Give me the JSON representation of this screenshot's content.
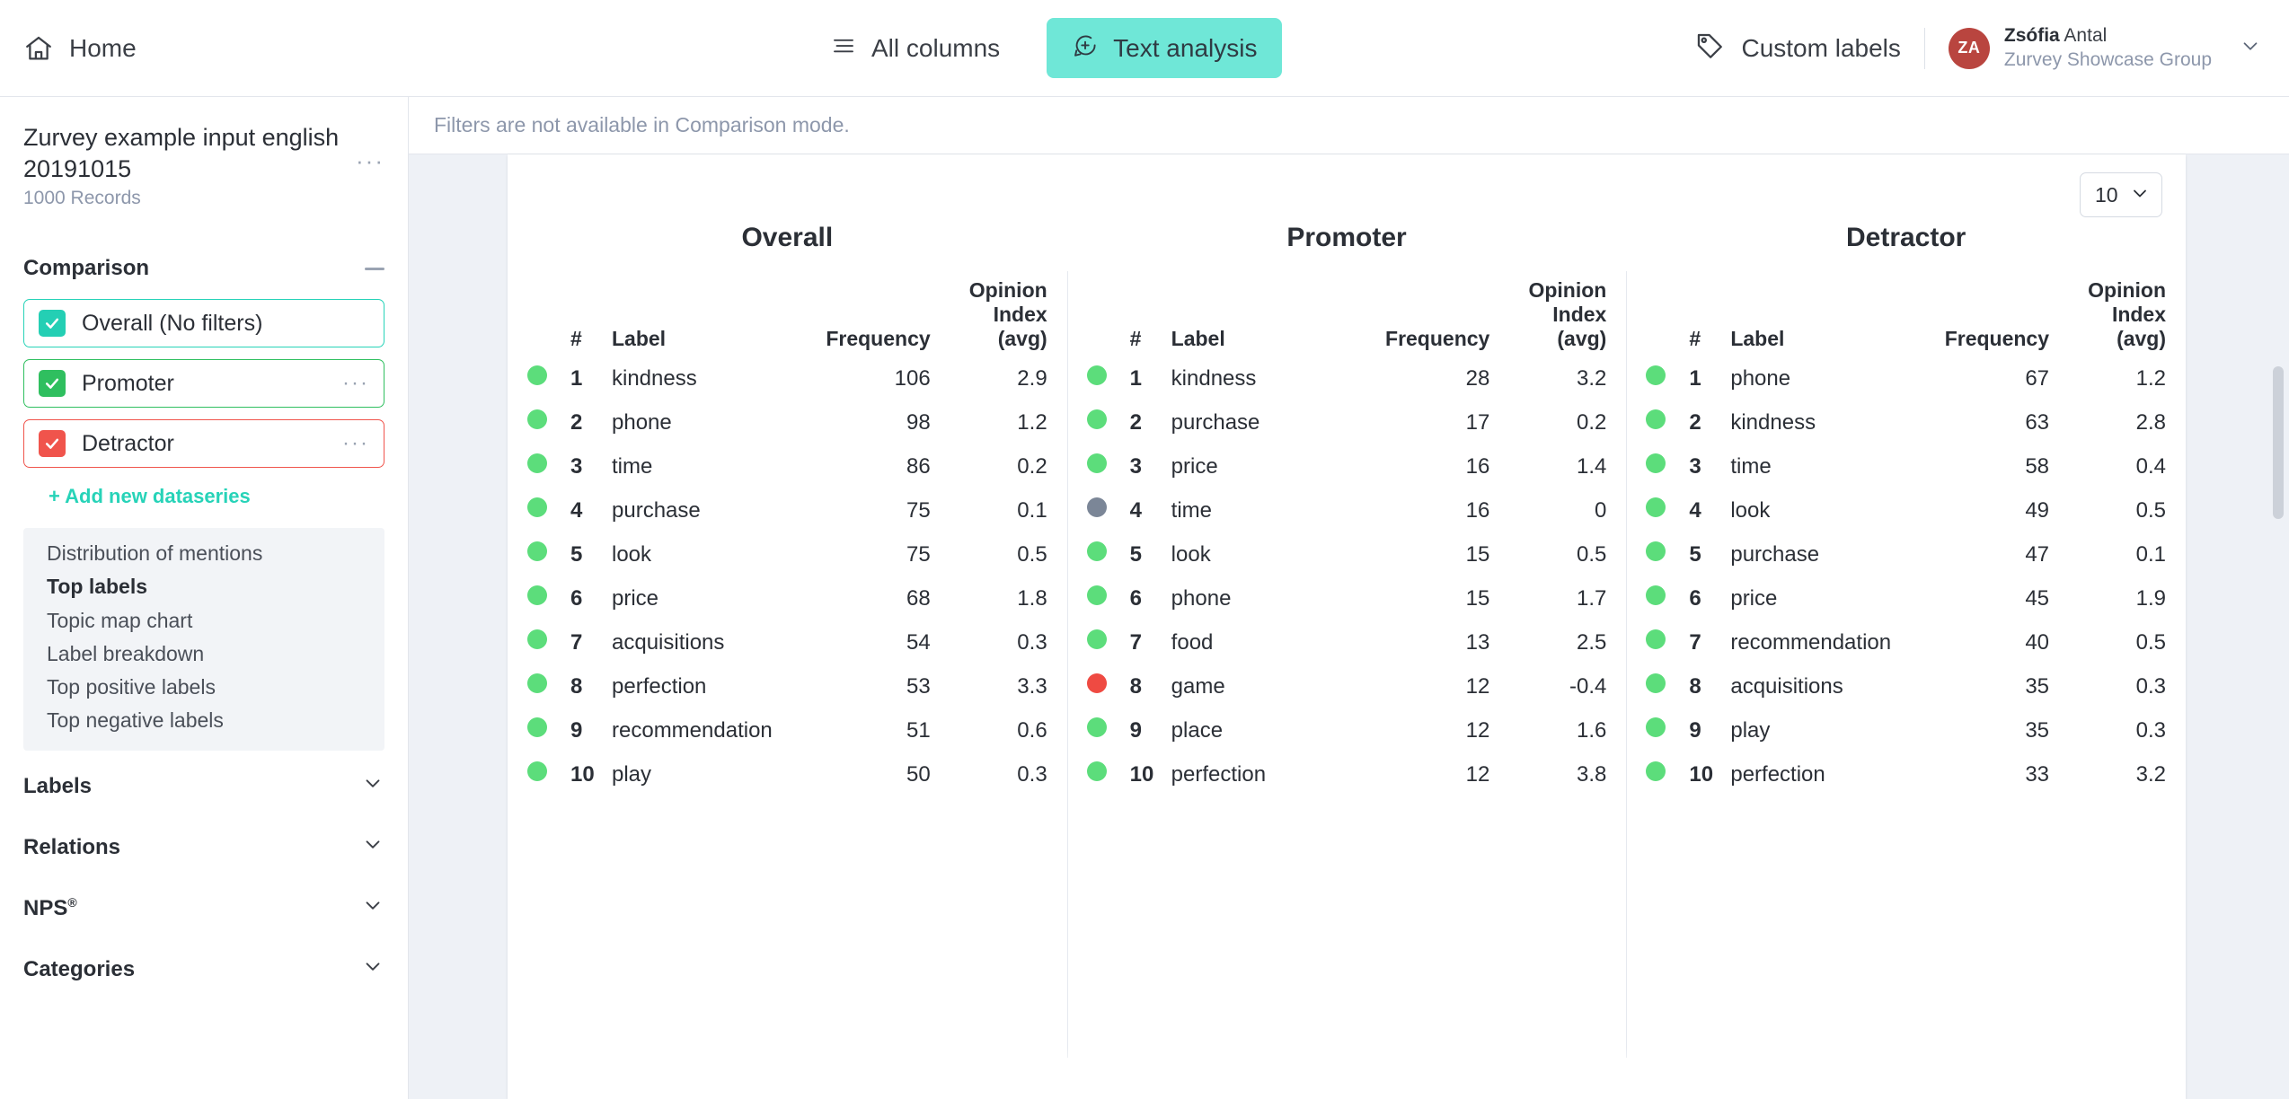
{
  "topbar": {
    "home_label": "Home",
    "all_columns_label": "All columns",
    "text_analysis_label": "Text analysis",
    "custom_labels_label": "Custom labels",
    "user_first_name": "Zsófia",
    "user_last_name": "Antal",
    "user_org": "Zurvey Showcase Group",
    "avatar_initials": "ZA",
    "accent_color": "#6fe7d7"
  },
  "sidebar": {
    "dataset_title": "Zurvey example input english 20191015",
    "dataset_records": "1000 Records",
    "more_options": "···",
    "comparison": {
      "heading": "Comparison",
      "collapse_icon": "minus-icon",
      "series": [
        {
          "label": "Overall (No filters)",
          "color": "#24cfb4",
          "checked": true,
          "has_menu": false
        },
        {
          "label": "Promoter",
          "color": "#2fbf5f",
          "checked": true,
          "has_menu": true,
          "menu": "···"
        },
        {
          "label": "Detractor",
          "color": "#f0544c",
          "checked": true,
          "has_menu": true,
          "menu": "···"
        }
      ],
      "add_series_label": "+ Add new dataseries"
    },
    "nav_items": [
      {
        "label": "Distribution of mentions",
        "active": false
      },
      {
        "label": "Top labels",
        "active": true
      },
      {
        "label": "Topic map chart",
        "active": false
      },
      {
        "label": "Label breakdown",
        "active": false
      },
      {
        "label": "Top positive labels",
        "active": false
      },
      {
        "label": "Top negative labels",
        "active": false
      }
    ],
    "accordions": [
      {
        "label": "Labels",
        "sup": ""
      },
      {
        "label": "Relations",
        "sup": ""
      },
      {
        "label": "NPS",
        "sup": "®"
      },
      {
        "label": "Categories",
        "sup": ""
      }
    ]
  },
  "main": {
    "filter_notice": "Filters are not available in Comparison mode.",
    "page_size_value": "10"
  },
  "chart_data": {
    "type": "table",
    "title": "Top labels",
    "columns": [
      "#",
      "Label",
      "Frequency",
      "Opinion Index (avg)"
    ],
    "column_headers": {
      "num": "#",
      "label": "Label",
      "frequency": "Frequency",
      "opinion_index_line1": "Opinion",
      "opinion_index_line2": "Index",
      "opinion_index_line3": "(avg)",
      "opinion_index_promoter_line1": "Opinion Index",
      "opinion_index_promoter_line2": "(avg)"
    },
    "series": [
      {
        "name": "Overall",
        "rows": [
          {
            "rank": "1",
            "label": "kindness",
            "frequency": "106",
            "opinion_index": "2.9",
            "sentiment": "pos"
          },
          {
            "rank": "2",
            "label": "phone",
            "frequency": "98",
            "opinion_index": "1.2",
            "sentiment": "pos"
          },
          {
            "rank": "3",
            "label": "time",
            "frequency": "86",
            "opinion_index": "0.2",
            "sentiment": "pos"
          },
          {
            "rank": "4",
            "label": "purchase",
            "frequency": "75",
            "opinion_index": "0.1",
            "sentiment": "pos"
          },
          {
            "rank": "5",
            "label": "look",
            "frequency": "75",
            "opinion_index": "0.5",
            "sentiment": "pos"
          },
          {
            "rank": "6",
            "label": "price",
            "frequency": "68",
            "opinion_index": "1.8",
            "sentiment": "pos"
          },
          {
            "rank": "7",
            "label": "acquisitions",
            "frequency": "54",
            "opinion_index": "0.3",
            "sentiment": "pos"
          },
          {
            "rank": "8",
            "label": "perfection",
            "frequency": "53",
            "opinion_index": "3.3",
            "sentiment": "pos"
          },
          {
            "rank": "9",
            "label": "recommendation",
            "frequency": "51",
            "opinion_index": "0.6",
            "sentiment": "pos"
          },
          {
            "rank": "10",
            "label": "play",
            "frequency": "50",
            "opinion_index": "0.3",
            "sentiment": "pos"
          }
        ]
      },
      {
        "name": "Promoter",
        "rows": [
          {
            "rank": "1",
            "label": "kindness",
            "frequency": "28",
            "opinion_index": "3.2",
            "sentiment": "pos"
          },
          {
            "rank": "2",
            "label": "purchase",
            "frequency": "17",
            "opinion_index": "0.2",
            "sentiment": "pos"
          },
          {
            "rank": "3",
            "label": "price",
            "frequency": "16",
            "opinion_index": "1.4",
            "sentiment": "pos"
          },
          {
            "rank": "4",
            "label": "time",
            "frequency": "16",
            "opinion_index": "0",
            "sentiment": "neu"
          },
          {
            "rank": "5",
            "label": "look",
            "frequency": "15",
            "opinion_index": "0.5",
            "sentiment": "pos"
          },
          {
            "rank": "6",
            "label": "phone",
            "frequency": "15",
            "opinion_index": "1.7",
            "sentiment": "pos"
          },
          {
            "rank": "7",
            "label": "food",
            "frequency": "13",
            "opinion_index": "2.5",
            "sentiment": "pos"
          },
          {
            "rank": "8",
            "label": "game",
            "frequency": "12",
            "opinion_index": "-0.4",
            "sentiment": "neg"
          },
          {
            "rank": "9",
            "label": "place",
            "frequency": "12",
            "opinion_index": "1.6",
            "sentiment": "pos"
          },
          {
            "rank": "10",
            "label": "perfection",
            "frequency": "12",
            "opinion_index": "3.8",
            "sentiment": "pos"
          }
        ]
      },
      {
        "name": "Detractor",
        "rows": [
          {
            "rank": "1",
            "label": "phone",
            "frequency": "67",
            "opinion_index": "1.2",
            "sentiment": "pos"
          },
          {
            "rank": "2",
            "label": "kindness",
            "frequency": "63",
            "opinion_index": "2.8",
            "sentiment": "pos"
          },
          {
            "rank": "3",
            "label": "time",
            "frequency": "58",
            "opinion_index": "0.4",
            "sentiment": "pos"
          },
          {
            "rank": "4",
            "label": "look",
            "frequency": "49",
            "opinion_index": "0.5",
            "sentiment": "pos"
          },
          {
            "rank": "5",
            "label": "purchase",
            "frequency": "47",
            "opinion_index": "0.1",
            "sentiment": "pos"
          },
          {
            "rank": "6",
            "label": "price",
            "frequency": "45",
            "opinion_index": "1.9",
            "sentiment": "pos"
          },
          {
            "rank": "7",
            "label": "recommendation",
            "frequency": "40",
            "opinion_index": "0.5",
            "sentiment": "pos"
          },
          {
            "rank": "8",
            "label": "acquisitions",
            "frequency": "35",
            "opinion_index": "0.3",
            "sentiment": "pos"
          },
          {
            "rank": "9",
            "label": "play",
            "frequency": "35",
            "opinion_index": "0.3",
            "sentiment": "pos"
          },
          {
            "rank": "10",
            "label": "perfection",
            "frequency": "33",
            "opinion_index": "3.2",
            "sentiment": "pos"
          }
        ]
      }
    ],
    "sentiment_colors": {
      "pos": "#5cdd7b",
      "neg": "#ef4a42",
      "neu": "#7b8697"
    }
  }
}
